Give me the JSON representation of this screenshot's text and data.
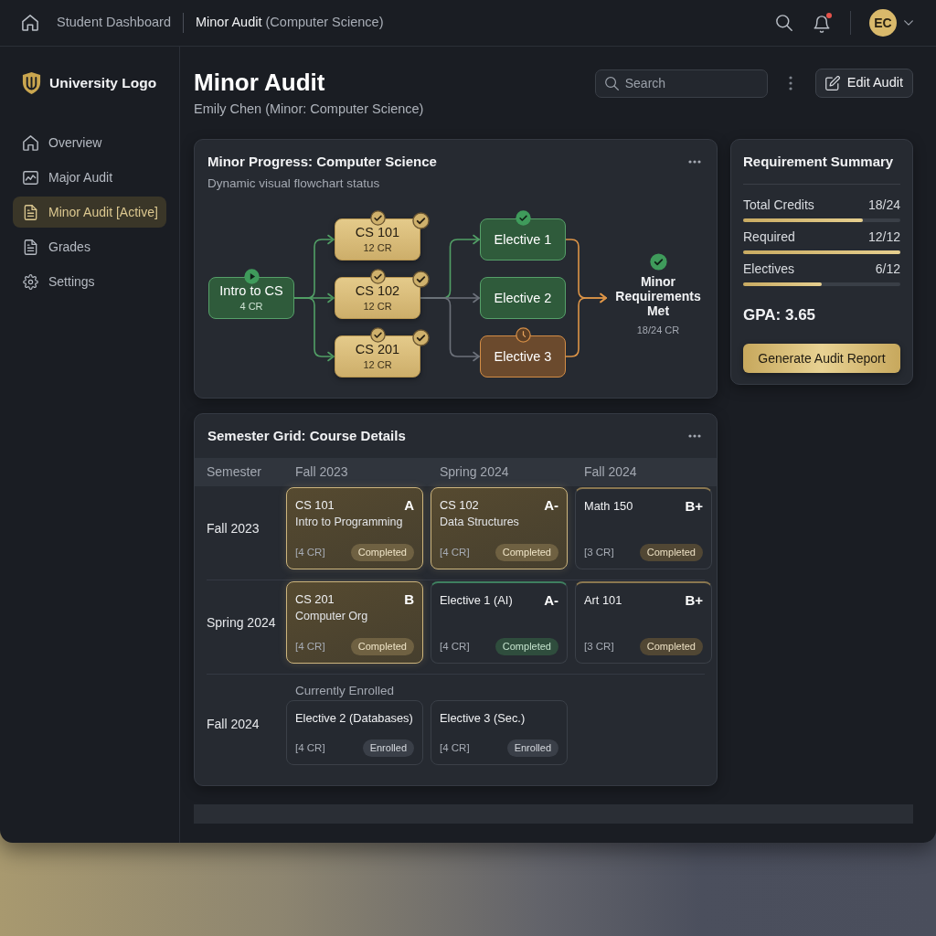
{
  "top_bar": {
    "breadcrumb": [
      "Student Dashboard",
      "**Minor Audit** (Computer Science)"
    ],
    "notifications": {
      "has_unread": true
    },
    "avatar": {
      "initials": "EC"
    }
  },
  "sidebar": {
    "logo": "University Logo",
    "items": [
      {
        "label": "Overview",
        "selected": false
      },
      {
        "label": "Major Audit",
        "selected": false
      },
      {
        "label": "Minor Audit [Active]",
        "selected": true
      },
      {
        "label": "Grades",
        "selected": false
      },
      {
        "label": "Settings",
        "selected": false
      }
    ]
  },
  "header": {
    "title": "Minor Audit",
    "subtitle": "Emily Chen (Minor: Computer Science)",
    "search": {
      "placeholder": "Search"
    },
    "edit_button": "Edit Audit"
  },
  "progress_card": {
    "title": "Minor Progress: Computer Science",
    "subtitle": "Dynamic visual flowchart status",
    "flowchart": {
      "columns": [
        [
          {
            "kind": "start",
            "label": "Intro to CS",
            "credits": "4 CR",
            "badges": [
              {
                "kind": "play"
              }
            ]
          }
        ],
        [
          {
            "kind": "core",
            "label": "CS 101",
            "credits": "12 CR",
            "badges": [
              {
                "kind": "check"
              },
              {
                "kind": "check"
              }
            ]
          },
          {
            "kind": "core",
            "label": "CS 102",
            "credits": "12 CR",
            "badges": [
              {
                "kind": "check"
              },
              {
                "kind": "check"
              }
            ]
          },
          {
            "kind": "core",
            "label": "CS 201",
            "credits": "12 CR",
            "badges": [
              {
                "kind": "check"
              },
              {
                "kind": "check"
              }
            ]
          }
        ],
        [
          {
            "kind": "elective",
            "label": "Elective 1",
            "badges": [
              {
                "kind": "check"
              }
            ]
          },
          {
            "kind": "elective",
            "label": "Elective 2"
          },
          {
            "kind": "pending",
            "label": "Elective 3",
            "badges": [
              {
                "kind": "clock"
              }
            ]
          }
        ]
      ],
      "goal": {
        "label": "Minor Requirements Met",
        "credits": "18/24 CR",
        "badges": [
          {
            "kind": "check"
          }
        ]
      }
    }
  },
  "summary": {
    "title": "Requirement Summary",
    "rows": [
      {
        "label": "Total Credits",
        "value": "18/24",
        "level": 0.76
      },
      {
        "label": "Required",
        "value": "12/12",
        "level": 1
      },
      {
        "label": "Electives",
        "value": "6/12",
        "level": 0.5
      }
    ],
    "gpa": "GPA: 3.65",
    "button": "Generate Audit Report"
  },
  "semester_grid": {
    "title": "Semester Grid: Course Details",
    "columns": [
      "Semester",
      "Fall 2023",
      "Spring 2024",
      "Fall 2024"
    ],
    "rows": [
      {
        "semester": "Fall 2023",
        "courses": [
          {
            "kind": "core",
            "code": "CS 101",
            "grade": "A",
            "title": "Intro to Programming",
            "credits": "[4 CR]",
            "status": "Completed"
          },
          {
            "kind": "core",
            "code": "CS 102",
            "grade": "A-",
            "title": "Data Structures",
            "credits": "[4 CR]",
            "status": "Completed"
          },
          {
            "kind": "general",
            "code": "Math 150",
            "grade": "B+",
            "credits": "[3 CR]",
            "status": "Completed"
          }
        ]
      },
      {
        "semester": "Spring 2024",
        "courses": [
          {
            "kind": "core",
            "code": "CS 201",
            "grade": "B",
            "title": "Computer Org",
            "credits": "[4 CR]",
            "status": "Completed"
          },
          {
            "kind": "elective",
            "code": "Elective 1 (AI)",
            "grade": "A-",
            "credits": "[4 CR]",
            "status": "Completed"
          },
          {
            "kind": "general",
            "code": "Art 101",
            "grade": "B+",
            "credits": "[3 CR]",
            "status": "Completed"
          }
        ]
      },
      {
        "semester": "Fall 2024",
        "note": "Currently Enrolled",
        "courses": [
          {
            "kind": "enrolled",
            "code": "Elective 2 (Databases)",
            "credits": "[4 CR]",
            "status": "Enrolled"
          },
          {
            "kind": "enrolled",
            "code": "Elective 3 (Sec.)",
            "credits": "[4 CR]",
            "status": "Enrolled"
          }
        ]
      }
    ]
  }
}
